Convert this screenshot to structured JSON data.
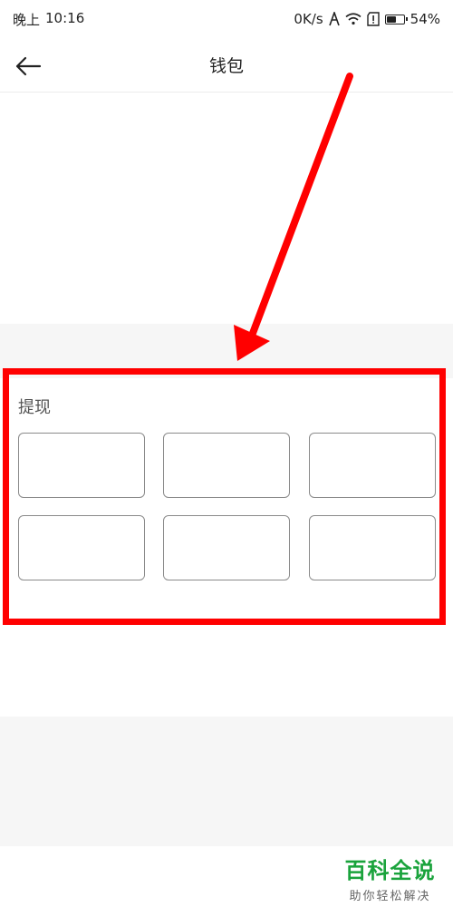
{
  "status_bar": {
    "time_prefix": "晚上",
    "time": "10:16",
    "network_speed": "0K/s",
    "battery_percent": "54%",
    "battery_level": 0.54,
    "icons": [
      "signal-a-icon",
      "wifi-icon",
      "sim-alert-icon",
      "battery-icon"
    ]
  },
  "nav": {
    "title": "钱包",
    "back_icon": "arrow-left-icon"
  },
  "withdraw": {
    "label": "提现",
    "options": [
      "",
      "",
      "",
      "",
      "",
      ""
    ]
  },
  "annotation": {
    "highlight_color": "#ff0000"
  },
  "watermark": {
    "title": "百科全说",
    "subtitle": "助你轻松解决"
  },
  "colors": {
    "accent_green": "#1aa33c",
    "annotation_red": "#ff0000"
  }
}
